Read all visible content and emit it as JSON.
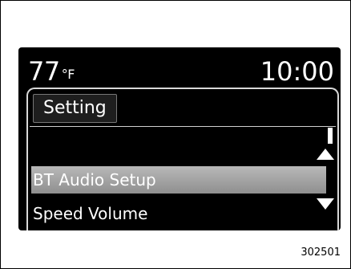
{
  "header": {
    "temperature": "77",
    "temperature_unit": "°F",
    "clock": "10:00"
  },
  "panel": {
    "tab_label": "Setting",
    "items": [
      {
        "label": "BT Audio Setup",
        "selected": true
      },
      {
        "label": "Speed Volume",
        "selected": false
      }
    ]
  },
  "figure_ref": "302501",
  "colors": {
    "screen_bg": "#000000",
    "text": "#ffffff",
    "selection": "#a8a8a8"
  }
}
